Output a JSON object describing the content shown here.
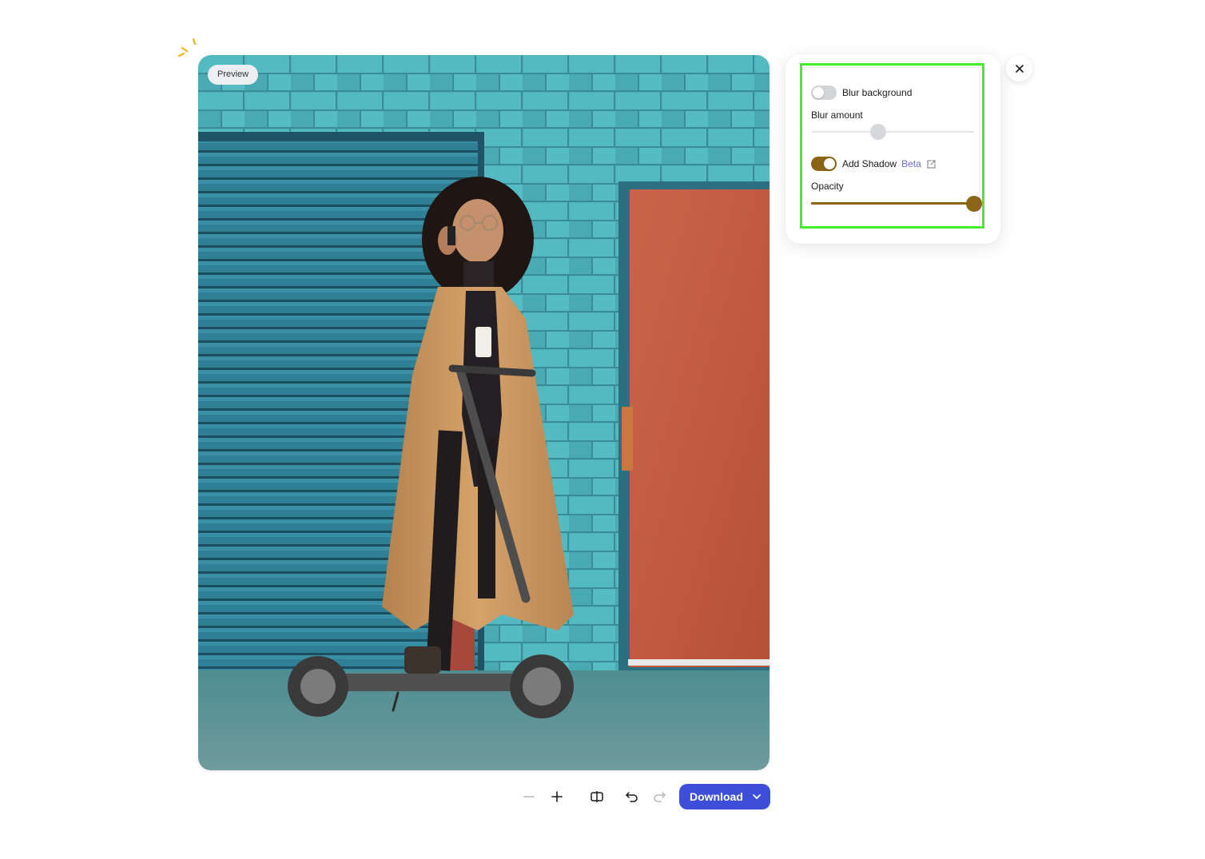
{
  "canvas": {
    "preview_label": "Preview",
    "image_alt": "Woman in a camel coat on a phone call standing on an electric scooter in front of a teal garage door and an orange door"
  },
  "panel": {
    "blur_background": {
      "label": "Blur background",
      "enabled": false
    },
    "blur_amount": {
      "label": "Blur amount",
      "value": 0.41,
      "disabled": true
    },
    "add_shadow": {
      "label": "Add Shadow",
      "badge": "Beta",
      "enabled": true
    },
    "opacity": {
      "label": "Opacity",
      "value": 1.0
    }
  },
  "toolbar": {
    "zoom_out_icon": "minus-icon",
    "zoom_in_icon": "plus-icon",
    "compare_icon": "compare-icon",
    "undo_icon": "undo-icon",
    "redo_icon": "redo-icon",
    "download_label": "Download"
  },
  "colors": {
    "accent": "#3d4fd9",
    "toggle_on": "#8a6515",
    "highlight": "#44ee2c",
    "beta": "#6b6fd6"
  }
}
